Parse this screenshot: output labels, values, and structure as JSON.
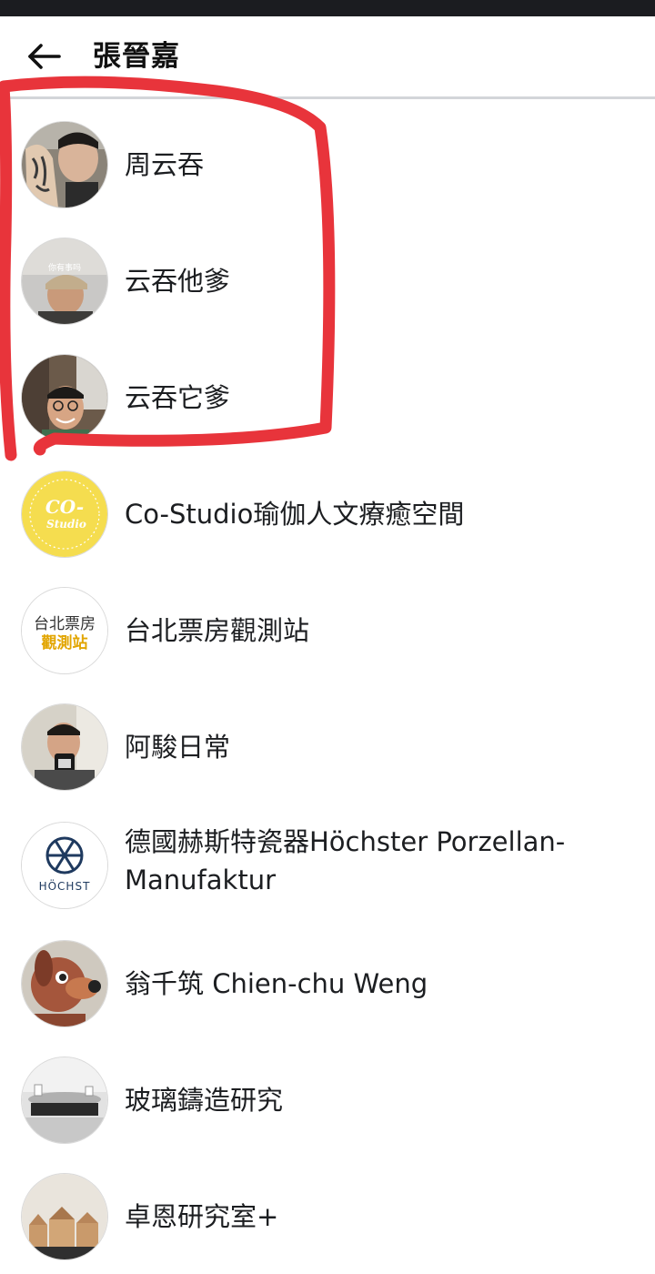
{
  "header": {
    "title": "張晉嘉",
    "back_icon": "arrow-left-icon"
  },
  "contacts": [
    {
      "name": "周云吞",
      "avatar": "photo-man-with-tattooed-hand"
    },
    {
      "name": "云吞他爹",
      "avatar": "photo-man-in-cap",
      "avatar_caption": "你有事吗"
    },
    {
      "name": "云吞它爹",
      "avatar": "photo-smiling-man-glasses"
    },
    {
      "name": "Co-Studio瑜伽人文療癒空間",
      "avatar": "co-studio-logo",
      "logo_line1": "CO-",
      "logo_line2": "Studio"
    },
    {
      "name": "台北票房觀測站",
      "avatar": "box-office-logo",
      "logo_line1": "台北票房",
      "logo_line2": "觀測站"
    },
    {
      "name": "阿駿日常",
      "avatar": "photo-man-holding-cup"
    },
    {
      "name": "德國赫斯特瓷器Höchster Porzellan-Manufaktur",
      "avatar": "hochst-logo",
      "logo_text": "HÖCHST"
    },
    {
      "name": "翁千筑 Chien-chu Weng",
      "avatar": "photo-dog-sculpture"
    },
    {
      "name": "玻璃鑄造研究",
      "avatar": "photo-glass-objects"
    },
    {
      "name": "卓恩研究室+",
      "avatar": "photo-wooden-houses"
    }
  ],
  "colors": {
    "status_bar": "#1b1c20",
    "divider": "#d3d5d9",
    "annotation_red": "#e8343b",
    "co_studio_yellow": "#f5dd4f",
    "box_office_gold": "#e2a500",
    "hochst_navy": "#1f3a5f"
  }
}
